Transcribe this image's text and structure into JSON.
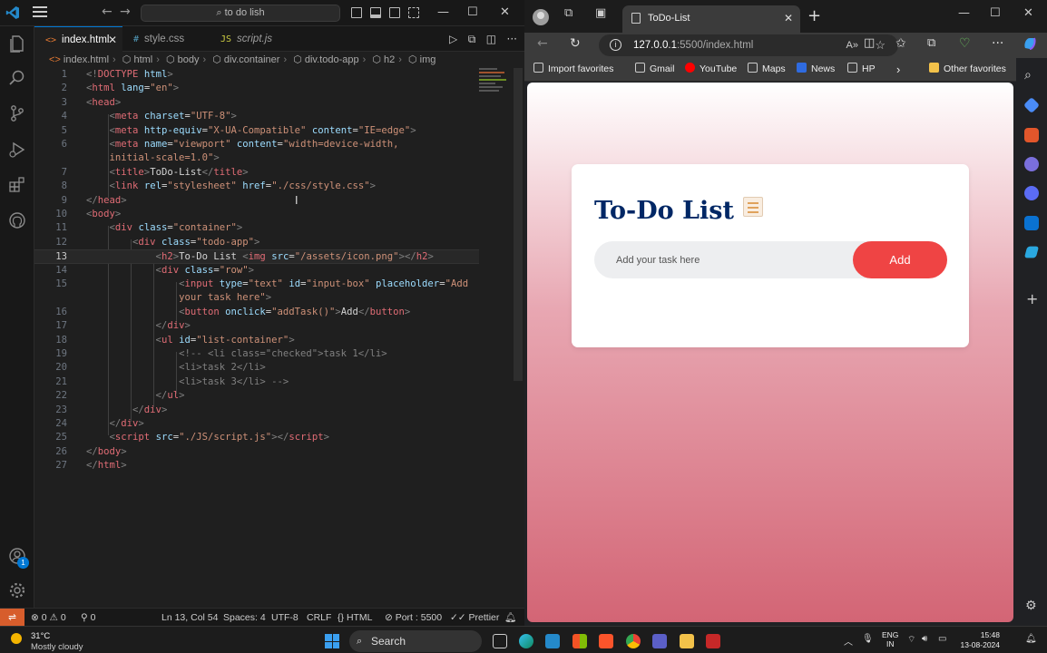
{
  "vscode": {
    "search_text": "to do lish",
    "tabs": [
      {
        "label": "index.html",
        "icon": "<>"
      },
      {
        "label": "style.css",
        "icon": "#"
      },
      {
        "label": "script.js",
        "icon": "JS"
      }
    ],
    "breadcrumb": [
      "index.html",
      "html",
      "body",
      "div.container",
      "div.todo-app",
      "h2",
      "img"
    ],
    "line_numbers": [
      "1",
      "2",
      "3",
      "4",
      "5",
      "",
      "6",
      "7",
      "8",
      "9",
      "10",
      "11",
      "12",
      "13",
      "14",
      "15",
      "",
      "16",
      "17",
      "18",
      "19",
      "20",
      "21",
      "22",
      "23",
      "24",
      "25",
      "26",
      "27"
    ],
    "status": {
      "errors": "0",
      "warnings": "0",
      "ports": "0",
      "position": "Ln 13, Col 54",
      "spaces": "Spaces: 4",
      "encoding": "UTF-8",
      "eol": "CRLF",
      "language": "HTML",
      "port": "Port : 5500",
      "prettier": "Prettier"
    },
    "account_badge": "1"
  },
  "edge": {
    "tab_title": "ToDo-List",
    "url_host": "127.0.0.1",
    "url_rest": ":5500/index.html",
    "favorites": [
      "Import favorites",
      "Gmail",
      "YouTube",
      "Maps",
      "News",
      "HP",
      "Other favorites"
    ]
  },
  "app": {
    "title": "To-Do List",
    "input_placeholder": "Add your task here",
    "add_label": "Add"
  },
  "taskbar": {
    "temp": "31°C",
    "weather": "Mostly cloudy",
    "search": "Search",
    "lang_top": "ENG",
    "lang_bottom": "IN",
    "time": "15:48",
    "date": "13-08-2024"
  },
  "colors": {
    "vscode_bg": "#1f1f1f",
    "title_color": "#002765",
    "add_button": "#ef4444",
    "gradient_bottom": "#d36575",
    "vscode_accent": "#0078d4"
  }
}
